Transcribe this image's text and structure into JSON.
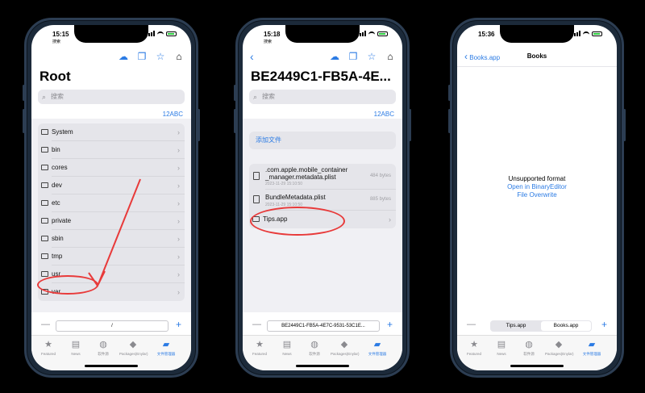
{
  "phone1": {
    "time": "15:15",
    "sub": "搜索",
    "title": "Root",
    "search_placeholder": "搜索",
    "index_label": "12ABC",
    "folders": [
      "System",
      "bin",
      "cores",
      "dev",
      "etc",
      "private",
      "sbin",
      "tmp",
      "usr",
      "var"
    ],
    "path": "/"
  },
  "phone2": {
    "time": "15:18",
    "sub": "搜索",
    "title": "BE2449C1-FB5A-4E...",
    "search_placeholder": "搜索",
    "index_label": "12ABC",
    "add_file": "添加文件",
    "files": [
      {
        "name_line1": ".com.apple.mobile_container",
        "name_line2": "_manager.metadata.plist",
        "date": "2023-11-29 15:10:50",
        "size": "484 bytes"
      },
      {
        "name_line1": "BundleMetadata.plist",
        "name_line2": "",
        "date": "2023-11-29 15:10:50",
        "size": "885 bytes"
      }
    ],
    "folder": "Tips.app",
    "path": "BE2449C1-FB5A-4E7C-9531-53C1E..."
  },
  "phone3": {
    "time": "15:36",
    "back_label": "Books.app",
    "nav_title": "Books",
    "message": "Unsupported format",
    "link1": "Open in BinaryEditor",
    "link2": "File Overwrite",
    "segments": [
      "Tips.app",
      "Books.app"
    ]
  },
  "tabs": [
    "Featured",
    "News",
    "软件源",
    "Packages(Enylar)",
    "文件管理器"
  ],
  "icons": {
    "share": "cloud-download-icon",
    "copy": "documents-icon",
    "star": "star-icon",
    "lock": "lock-icon"
  },
  "colors": {
    "accent": "#2b7be4",
    "annotation": "#e83a3a",
    "frame": "#1c2a3a"
  }
}
